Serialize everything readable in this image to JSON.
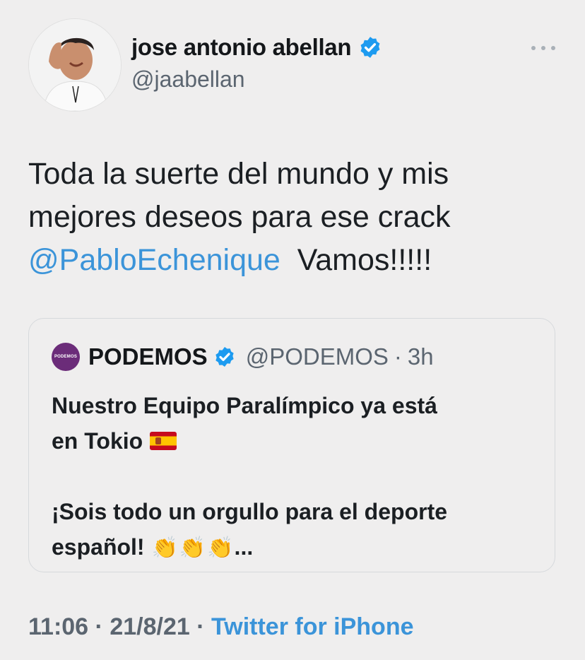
{
  "author": {
    "name": "jose antonio abellan",
    "handle": "@jaabellan",
    "verified": true
  },
  "tweet": {
    "text_line1": "Toda la suerte del mundo y mis",
    "text_line2": "mejores deseos para ese crack",
    "mention": "@PabloEchenique",
    "text_after_mention": "Vamos!!!!!"
  },
  "quoted": {
    "logo_text": "PODEMOS",
    "name": "PODEMOS",
    "handle": "@PODEMOS",
    "separator": "·",
    "time": "3h",
    "line1": "Nuestro Equipo Paralímpico ya está",
    "line2": "en Tokio",
    "line3": "¡Sois todo un orgullo para el deporte",
    "line4": "español!",
    "clap_emoji": "👏",
    "ellipsis": "..."
  },
  "footer": {
    "time": "11:06",
    "separator": "·",
    "date": "21/8/21",
    "source": "Twitter for iPhone"
  },
  "colors": {
    "background": "#efeeee",
    "link": "#3b94d9",
    "verified": "#1d9bf0",
    "podemos": "#6b2c79"
  }
}
